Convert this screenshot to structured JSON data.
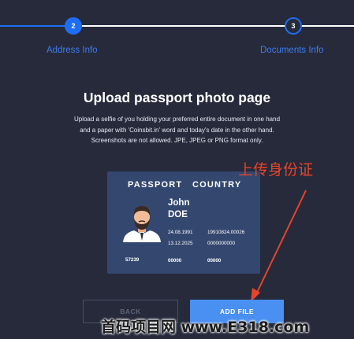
{
  "stepper": {
    "steps": [
      {
        "number": "2",
        "label": "Address Info",
        "state": "active"
      },
      {
        "number": "3",
        "label": "Documents Info",
        "state": "upcoming"
      }
    ],
    "colors": {
      "active": "#1e6ef5",
      "line_done": "#1e6ef5",
      "line_pending": "#ffffff"
    }
  },
  "upload": {
    "title": "Upload passport photo page",
    "description_lines": [
      "Upload a selfie of you holding your preferred entire document in one hand",
      "and a paper with 'Coinsbit.in' word and today's date in the other hand.",
      "Screenshots are not allowed. JPE, JPEG or PNG format only."
    ]
  },
  "passport_card": {
    "header_left": "PASSPORT",
    "header_right": "COUNTRY",
    "first_name": "John",
    "last_name": "DOE",
    "birth_date": "24.08.1991",
    "issue_date": "13.12.2025",
    "id_number": "19910824.00026",
    "doc_number": "0000000000",
    "footer": [
      "57239",
      "00000",
      "00000"
    ],
    "avatar_icon": "person-avatar-icon"
  },
  "annotation": {
    "text": "上传身份证",
    "arrow_icon": "arrow-icon",
    "color": "#e8442a"
  },
  "buttons": {
    "back": "BACK",
    "add_file": "ADD FILE"
  },
  "watermark": {
    "text": "首码项目网 www.E318.com"
  }
}
